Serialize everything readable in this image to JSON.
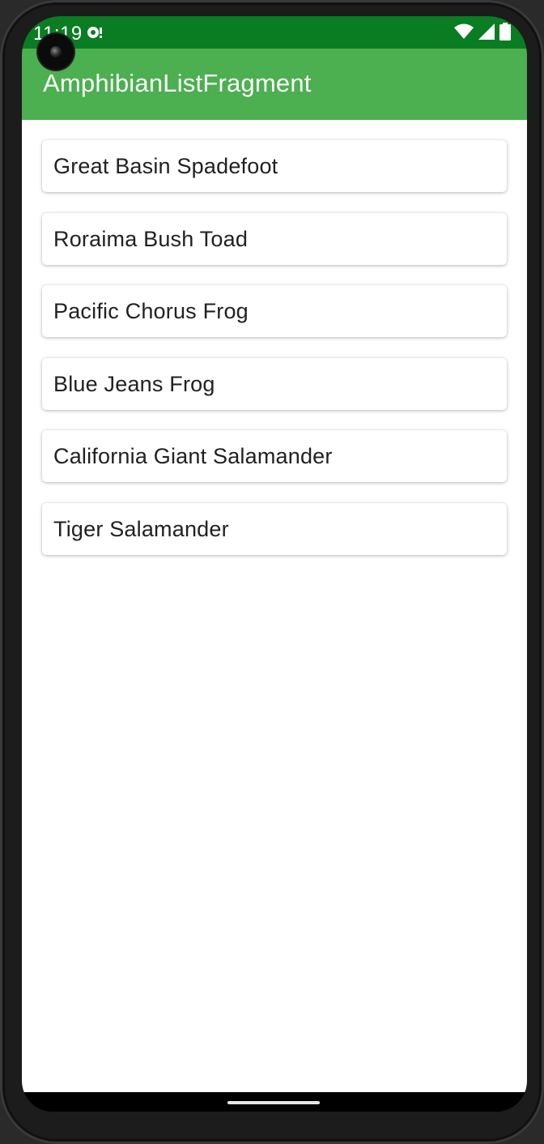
{
  "status_bar": {
    "time": "11:19",
    "icons": [
      "notification-icon",
      "wifi-icon",
      "signal-icon",
      "battery-icon"
    ],
    "color": "#0a7d22"
  },
  "app_bar": {
    "title": "AmphibianListFragment",
    "color": "#4caf50"
  },
  "amphibians": [
    {
      "name": "Great Basin Spadefoot"
    },
    {
      "name": "Roraima Bush Toad"
    },
    {
      "name": "Pacific Chorus Frog"
    },
    {
      "name": "Blue Jeans Frog"
    },
    {
      "name": "California Giant Salamander"
    },
    {
      "name": "Tiger Salamander"
    }
  ]
}
